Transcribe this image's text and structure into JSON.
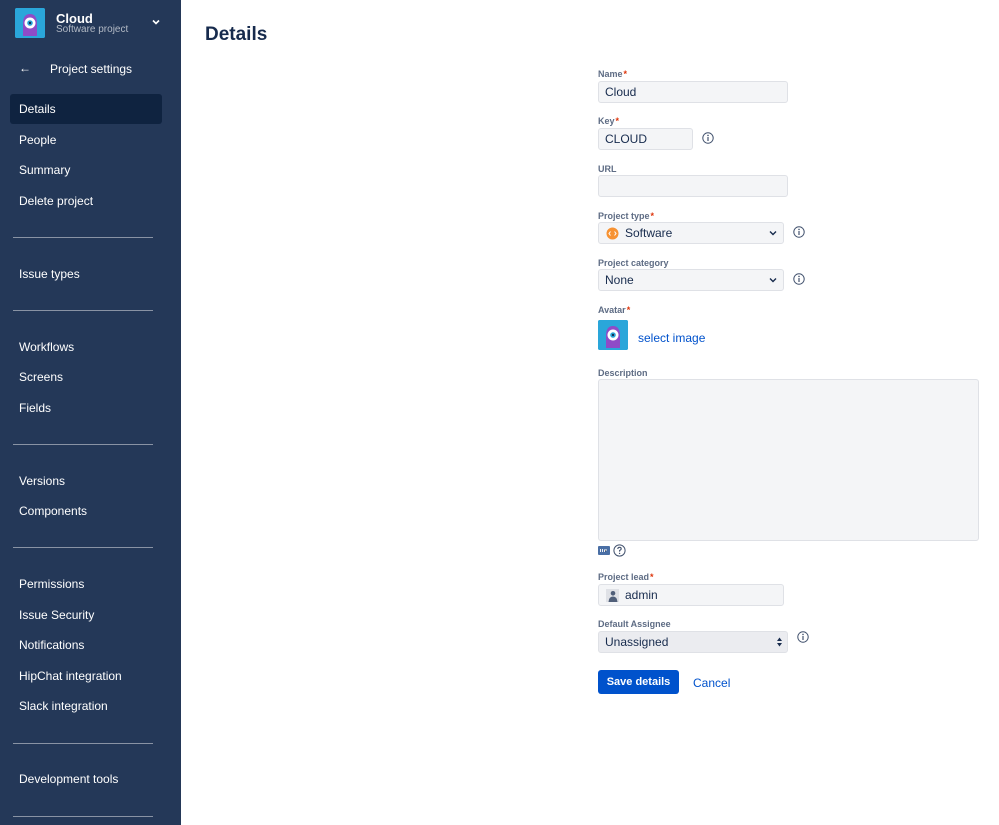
{
  "project": {
    "name": "Cloud",
    "type": "Software project"
  },
  "sidebar": {
    "back_label": "Project settings",
    "groups": [
      [
        "Details",
        "People",
        "Summary",
        "Delete project"
      ],
      [
        "Issue types"
      ],
      [
        "Workflows",
        "Screens",
        "Fields"
      ],
      [
        "Versions",
        "Components"
      ],
      [
        "Permissions",
        "Issue Security",
        "Notifications",
        "HipChat integration",
        "Slack integration"
      ],
      [
        "Development tools"
      ]
    ],
    "active_item": "Details"
  },
  "page": {
    "title": "Details"
  },
  "form": {
    "name": {
      "label": "Name",
      "value": "Cloud"
    },
    "key": {
      "label": "Key",
      "value": "CLOUD"
    },
    "url": {
      "label": "URL",
      "value": ""
    },
    "project_type": {
      "label": "Project type",
      "value": "Software"
    },
    "project_category": {
      "label": "Project category",
      "value": "None"
    },
    "avatar": {
      "label": "Avatar",
      "link": "select image"
    },
    "description": {
      "label": "Description",
      "value": ""
    },
    "project_lead": {
      "label": "Project lead",
      "value": "admin"
    },
    "default_assignee": {
      "label": "Default Assignee",
      "value": "Unassigned"
    },
    "save_label": "Save details",
    "cancel_label": "Cancel",
    "required_mark": "*"
  },
  "colors": {
    "sidebar_bg": "#243858",
    "active_nav": "#0f2340",
    "primary": "#0052cc",
    "link": "#0052cc",
    "required": "#de350b",
    "project_type_icon": "#f79232"
  }
}
